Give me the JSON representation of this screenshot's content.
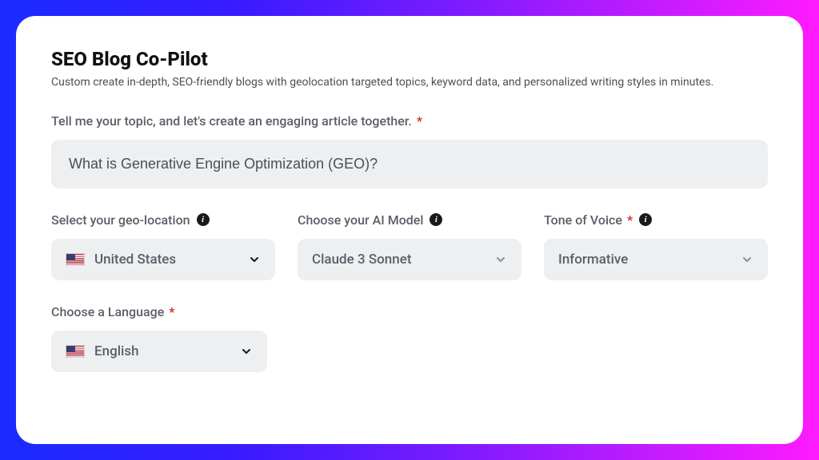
{
  "header": {
    "title": "SEO Blog Co-Pilot",
    "subtitle": "Custom create in-depth, SEO-friendly blogs with geolocation targeted topics, keyword data, and personalized writing styles in minutes."
  },
  "topic": {
    "label": "Tell me your topic, and let's create an engaging article together.",
    "required": "*",
    "value": "What is Generative Engine Optimization (GEO)?"
  },
  "geo": {
    "label": "Select your geo-location",
    "value": "United States"
  },
  "model": {
    "label": "Choose your AI Model",
    "value": "Claude 3 Sonnet"
  },
  "tone": {
    "label": "Tone of Voice",
    "required": "*",
    "value": "Informative"
  },
  "language": {
    "label": "Choose a Language",
    "required": "*",
    "value": "English"
  }
}
